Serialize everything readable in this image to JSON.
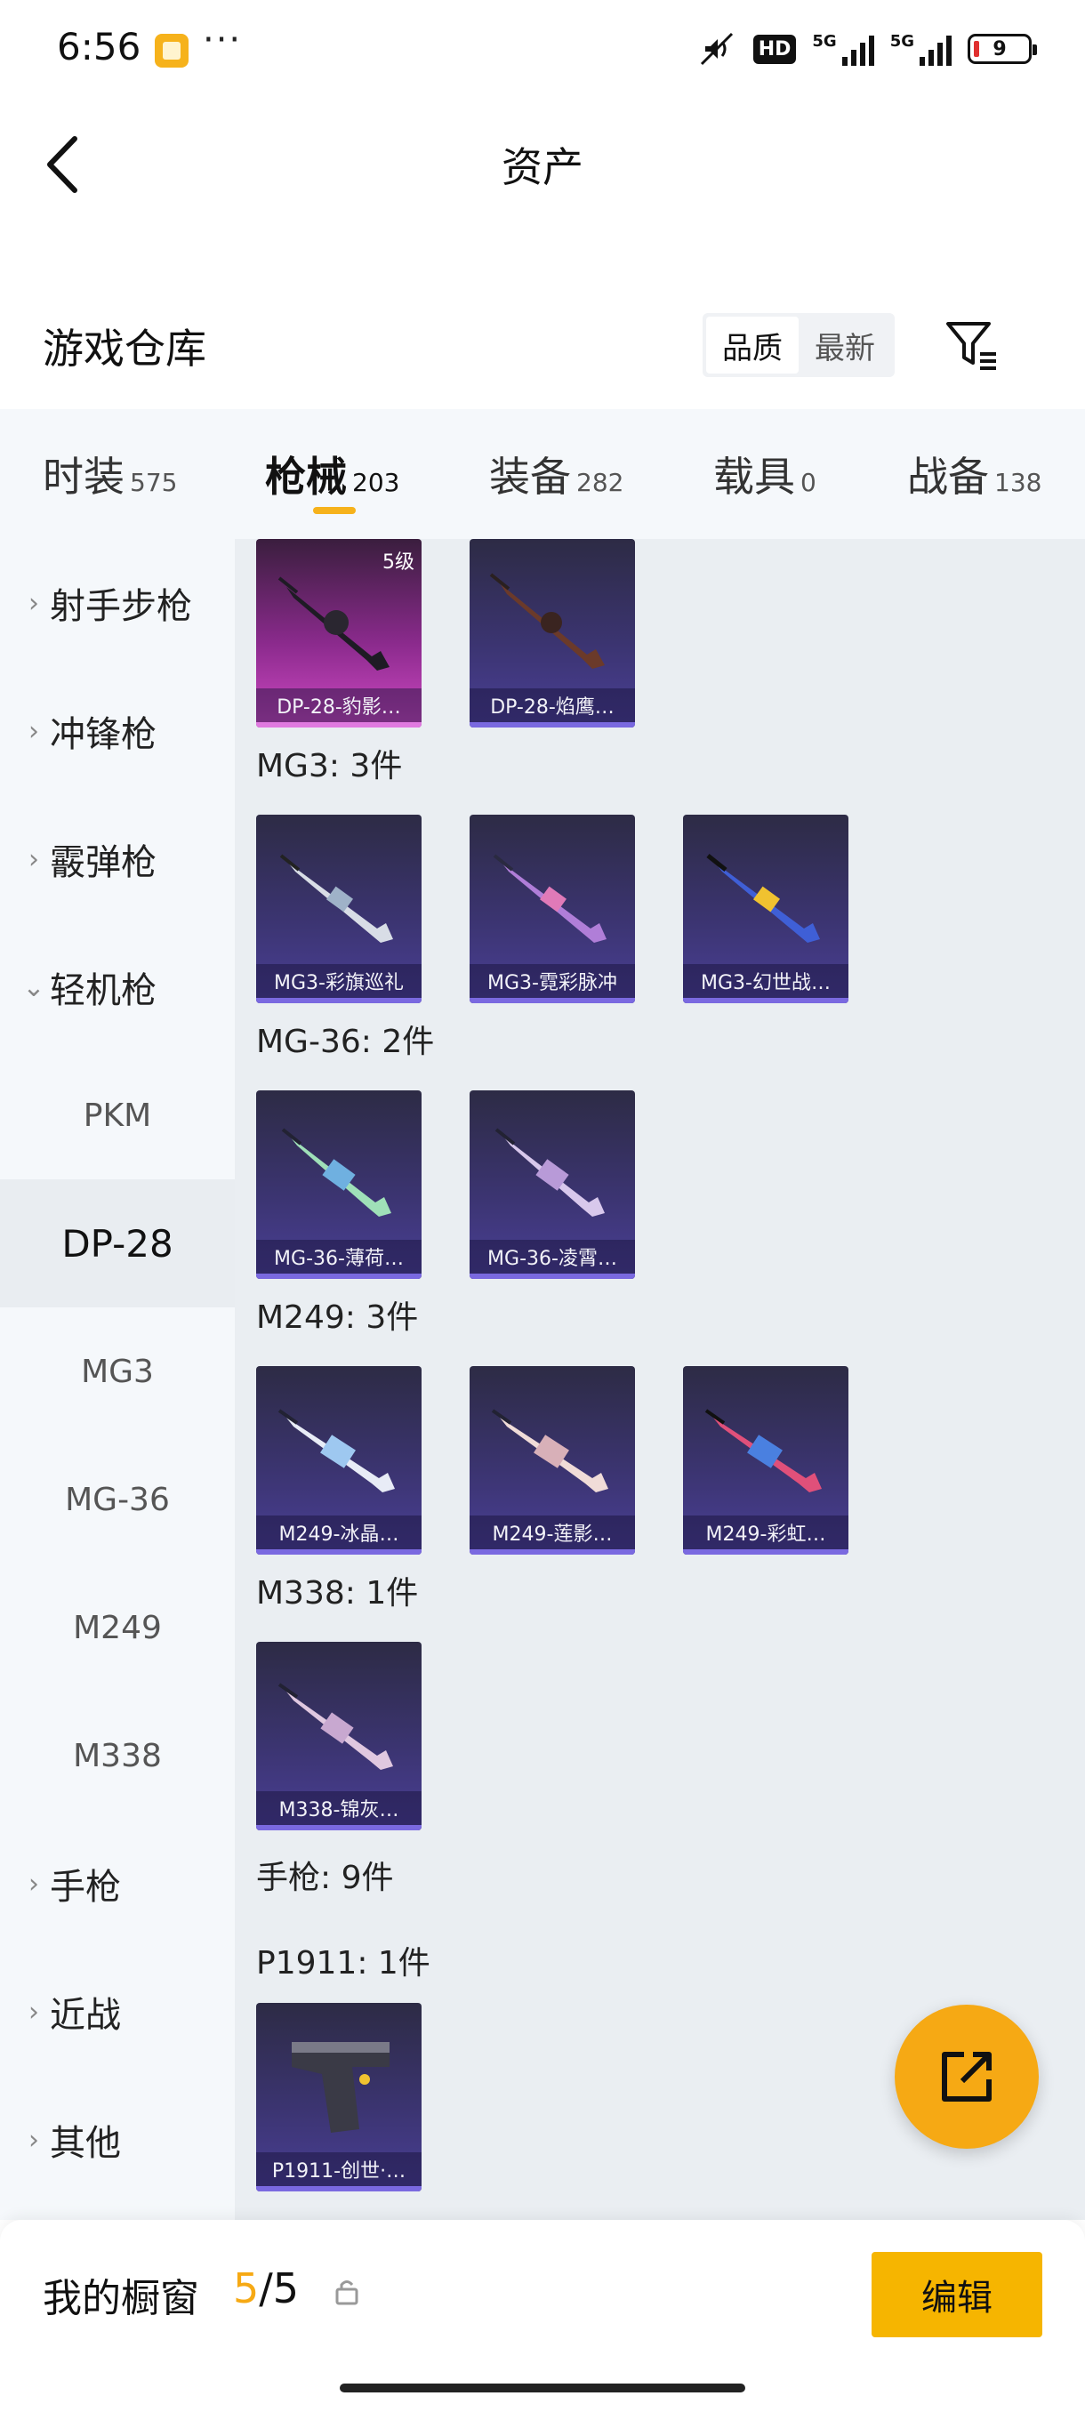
{
  "status_bar": {
    "time": "6:56",
    "dots": "···",
    "hd": "HD",
    "net1": "5G",
    "net2": "5G",
    "battery": "9"
  },
  "header": {
    "title": "资产",
    "back_icon": "chevron-left-icon"
  },
  "warehouse": {
    "title": "游戏仓库",
    "sort_options": [
      "品质",
      "最新"
    ],
    "active_sort": "品质",
    "filter_icon": "filter-icon"
  },
  "tabs": [
    {
      "label": "时装",
      "count": "575"
    },
    {
      "label": "枪械",
      "count": "203",
      "active": true
    },
    {
      "label": "装备",
      "count": "282"
    },
    {
      "label": "载具",
      "count": "0"
    },
    {
      "label": "战备",
      "count": "138"
    }
  ],
  "sidebar": {
    "categories": [
      "射手步枪",
      "冲锋枪",
      "霰弹枪",
      "轻机枪",
      "手枪",
      "近战",
      "其他"
    ],
    "subitems": [
      "PKM",
      "DP-28",
      "MG3",
      "MG-36",
      "M249",
      "M338"
    ],
    "active_subitem": "DP-28"
  },
  "content": {
    "top_cards": [
      {
        "name": "DP-28-豹影…",
        "badge": "5级",
        "style": "pink"
      },
      {
        "name": "DP-28-焰鹰…"
      }
    ],
    "groups": [
      {
        "title": "MG3: 3件",
        "cards": [
          "MG3-彩旗巡礼",
          "MG3-霓彩脉冲",
          "MG3-幻世战…"
        ]
      },
      {
        "title": "MG-36: 2件",
        "cards": [
          "MG-36-薄荷…",
          "MG-36-凌霄…"
        ]
      },
      {
        "title": "M249: 3件",
        "cards": [
          "M249-冰晶…",
          "M249-莲影…",
          "M249-彩虹…"
        ]
      },
      {
        "title": "M338: 1件",
        "cards": [
          "M338-锦灰…"
        ]
      }
    ],
    "pistol_header": "手枪: 9件",
    "pistol_group": {
      "title": "P1911: 1件",
      "cards": [
        "P1911-创世·…"
      ]
    }
  },
  "fab": {
    "icon": "share-icon"
  },
  "bottom_bar": {
    "label": "我的橱窗",
    "current": "5",
    "separator": "/",
    "total": "5",
    "lock_icon": "lock-icon",
    "edit_label": "编辑"
  },
  "colors": {
    "accent": "#f6b21b",
    "card_purple": "#3b3470",
    "card_pink": "#d049c4"
  }
}
